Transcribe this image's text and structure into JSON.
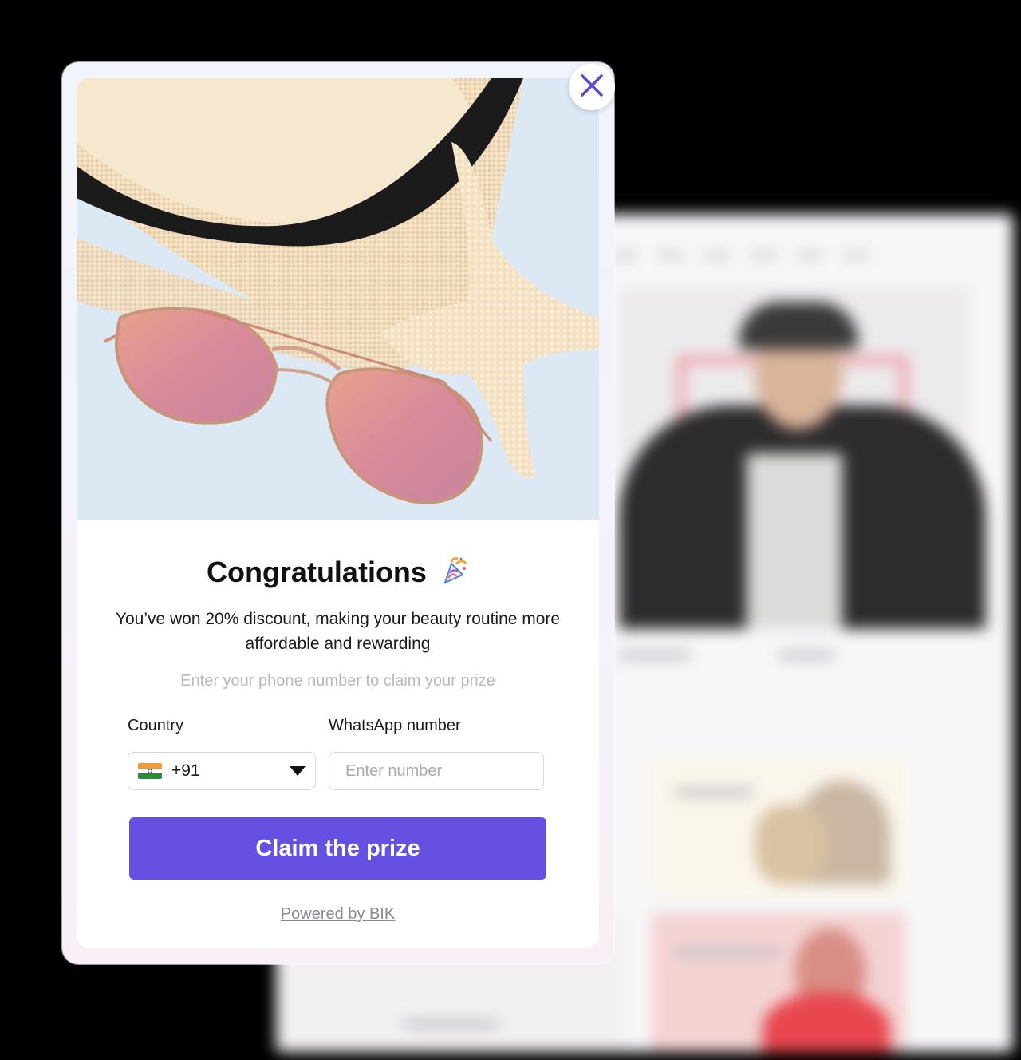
{
  "popup": {
    "title": "Congratulations",
    "subtitle": "You’ve won 20% discount, making your beauty routine more affordable and rewarding",
    "hint": "Enter your phone number to claim your prize",
    "country_label": "Country",
    "country_code": "+91",
    "whatsapp_label": "WhatsApp number",
    "phone_placeholder": "Enter number",
    "claim_button": "Claim the prize",
    "powered_by": "Powered by BIK"
  },
  "colors": {
    "accent": "#6550e2",
    "close_icon": "#5b46d6"
  },
  "icons": [
    "close-icon",
    "confetti-icon",
    "india-flag-icon",
    "dropdown-caret-icon"
  ]
}
